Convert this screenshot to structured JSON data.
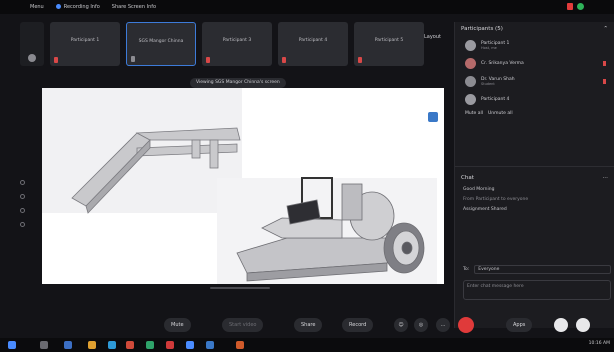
{
  "topbar": {
    "menu_label": "Menu",
    "recording_label": "Recording Info",
    "share_label": "Share Screen Info"
  },
  "strip": {
    "tiles": [
      {
        "name": "Participant 1",
        "sub": ""
      },
      {
        "name": "SGS Mangor Chinna",
        "sub": ""
      },
      {
        "name": "Participant 3",
        "sub": ""
      },
      {
        "name": "Participant 4",
        "sub": ""
      },
      {
        "name": "Participant 5",
        "sub": ""
      }
    ],
    "layout_label": "Layout"
  },
  "viewing_label": "Viewing SGS Mangor Chinna's screen",
  "panel": {
    "participants_title": "Participants (5)",
    "participants": [
      {
        "name": "Participant 1",
        "sub": "Host, me"
      },
      {
        "name": "Cr. Srikanya Verma",
        "sub": ""
      },
      {
        "name": "Dr. Varun Shah",
        "sub": "Student"
      },
      {
        "name": "Participant 4",
        "sub": ""
      }
    ],
    "mute_all": "Mute all",
    "unmute_all": "Unmute all",
    "chat_title": "Chat",
    "chat_lines": [
      {
        "text": "Good Morning",
        "meta": false
      },
      {
        "text": "From Participant to everyone",
        "meta": true
      },
      {
        "text": "Assignment Shared",
        "meta": false
      }
    ],
    "to_label": "To:",
    "to_value": "Everyone",
    "chat_placeholder": "Enter chat message here"
  },
  "controls": {
    "mute": "Mute",
    "stop_video": "Start video",
    "share": "Share",
    "record": "Record",
    "more": "...",
    "apps": "Apps"
  },
  "taskbar": {
    "time": "10:16 AM"
  },
  "colors": {
    "accent": "#3d7bd9",
    "danger": "#e03a3a",
    "panel_bg": "#1c1c20"
  }
}
